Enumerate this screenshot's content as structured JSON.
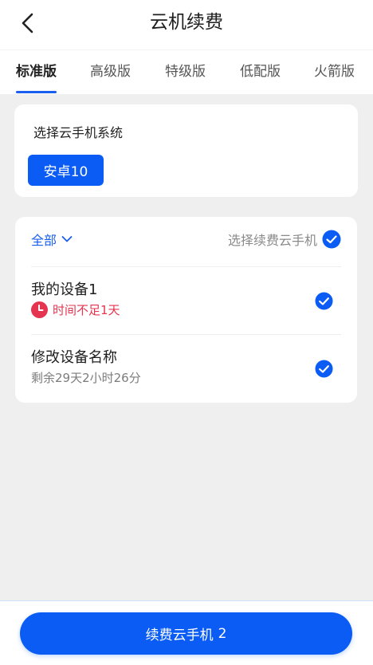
{
  "header": {
    "title": "云机续费"
  },
  "tabs": [
    {
      "label": "标准版",
      "active": true
    },
    {
      "label": "高级版",
      "active": false
    },
    {
      "label": "特级版",
      "active": false
    },
    {
      "label": "低配版",
      "active": false
    },
    {
      "label": "火箭版",
      "active": false
    }
  ],
  "system": {
    "label": "选择云手机系统",
    "selected": "安卓10"
  },
  "devices": {
    "filter_label": "全部",
    "select_label": "选择续费云手机",
    "items": [
      {
        "name": "我的设备1",
        "status": "时间不足1天",
        "status_type": "warning",
        "checked": true
      },
      {
        "name": "修改设备名称",
        "status": "剩余29天2小时26分",
        "status_type": "normal",
        "checked": true
      }
    ]
  },
  "bottom": {
    "button_label": "续费云手机",
    "count": "2"
  },
  "colors": {
    "accent": "#0a5cf5",
    "warning": "#e5344f",
    "background": "#efefef"
  }
}
